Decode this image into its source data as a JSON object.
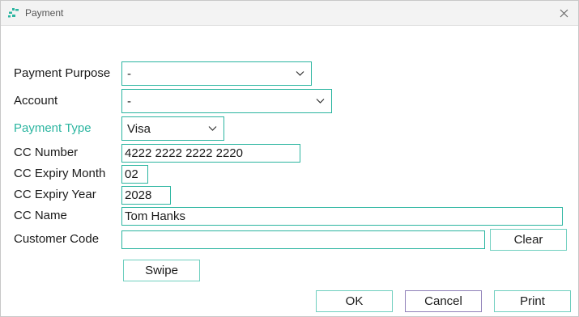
{
  "window": {
    "title": "Payment"
  },
  "form": {
    "payment_purpose": {
      "label": "Payment Purpose",
      "value": "-"
    },
    "account": {
      "label": "Account",
      "value": "-"
    },
    "payment_type": {
      "label": "Payment Type",
      "value": "Visa"
    },
    "cc_number": {
      "label": "CC Number",
      "value": "4222 2222 2222 2220"
    },
    "cc_expiry_month": {
      "label": "CC Expiry Month",
      "value": "02"
    },
    "cc_expiry_year": {
      "label": "CC Expiry Year",
      "value": "2028"
    },
    "cc_name": {
      "label": "CC Name",
      "value": "Tom Hanks"
    },
    "customer_code": {
      "label": "Customer Code",
      "value": ""
    }
  },
  "buttons": {
    "clear": "Clear",
    "swipe": "Swipe",
    "ok": "OK",
    "cancel": "Cancel",
    "print": "Print"
  },
  "colors": {
    "accent": "#2bb5a0",
    "cancel_border": "#8f7fb8"
  },
  "icons": {
    "app": "app-logo-icon",
    "close": "close-icon",
    "dropdown": "chevron-down-icon"
  }
}
